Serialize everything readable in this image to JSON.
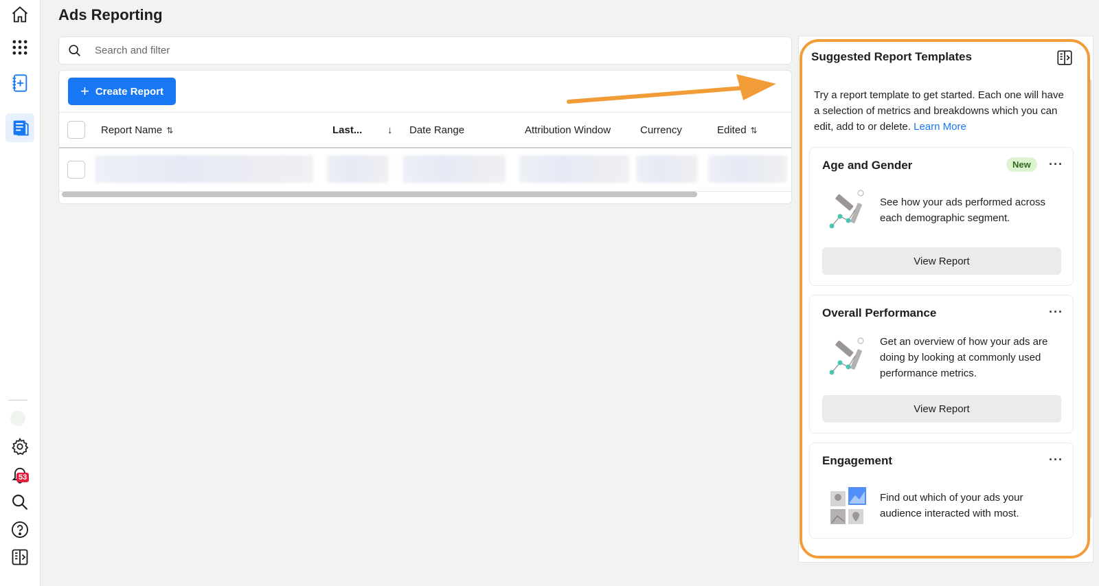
{
  "page": {
    "title": "Ads Reporting"
  },
  "nav": {
    "notification_count": "53"
  },
  "search": {
    "placeholder": "Search and filter"
  },
  "toolbar": {
    "create_label": "Create Report"
  },
  "table": {
    "columns": [
      "Report Name",
      "Last...",
      "Date Range",
      "Attribution Window",
      "Currency",
      "Edited"
    ],
    "sort_up_down": "⇅",
    "sort_down": "↓"
  },
  "panel": {
    "title": "Suggested Report Templates",
    "intro": "Try a report template to get started. Each one will have a selection of metrics and breakdowns which you can edit, add to or delete.",
    "learn_more": "Learn More",
    "templates": [
      {
        "title": "Age and Gender",
        "badge": "New",
        "description": "See how your ads performed across each demographic segment.",
        "button": "View Report"
      },
      {
        "title": "Overall Performance",
        "description": "Get an overview of how your ads are doing by looking at commonly used performance metrics.",
        "button": "View Report"
      },
      {
        "title": "Engagement",
        "description": "Find out which of your ads your audience interacted with most."
      }
    ],
    "more_symbol": "···"
  },
  "colors": {
    "primary": "#1877f2",
    "highlight": "#f29c38",
    "badge_red": "#e41e3f",
    "new_badge_bg": "#dcf4d2"
  }
}
